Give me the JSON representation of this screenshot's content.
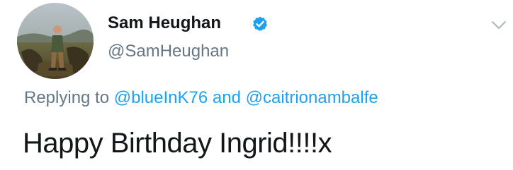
{
  "author": {
    "display_name": "Sam Heughan",
    "handle": "@SamHeughan",
    "verified": true,
    "avatar_icon": "profile-photo"
  },
  "reply": {
    "prefix": "Replying to",
    "recipients": [
      "@blueInK76",
      "@caitrionambalfe"
    ],
    "conjunction": "and"
  },
  "tweet": {
    "text": "Happy Birthday Ingrid!!!!x"
  },
  "colors": {
    "link": "#1da1f2",
    "secondary_text": "#657786",
    "primary_text": "#14171a",
    "verified_badge": "#1da1f2"
  },
  "icons": {
    "verified": "verified-badge-icon",
    "menu": "chevron-down-icon"
  }
}
